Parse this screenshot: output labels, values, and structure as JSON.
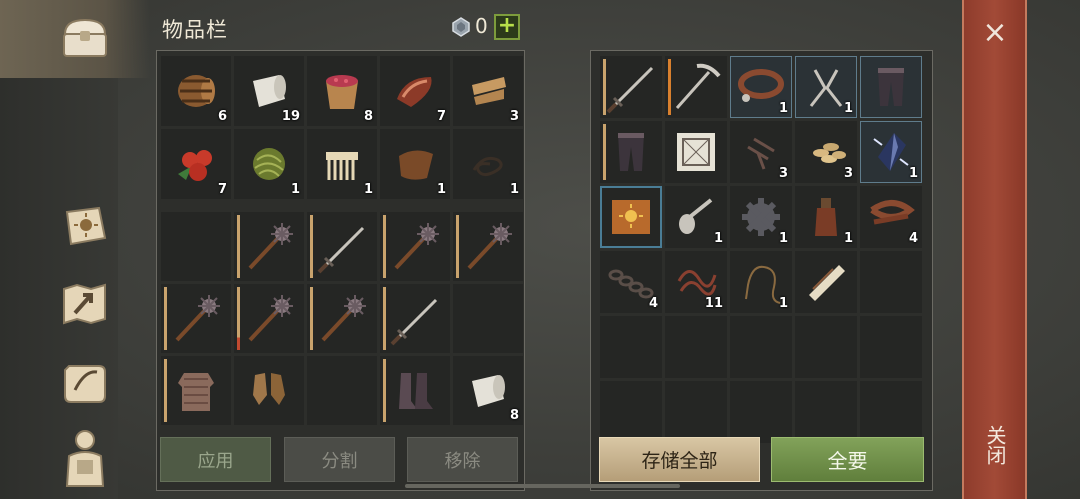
{
  "header": {
    "title": "物品栏",
    "gem_count": "0",
    "plus_label": "+"
  },
  "left_top": [
    {
      "icon": "barrel",
      "count": "6"
    },
    {
      "icon": "cloth-roll",
      "count": "19"
    },
    {
      "icon": "berry-bucket",
      "count": "8"
    },
    {
      "icon": "raw-meat",
      "count": "7"
    },
    {
      "icon": "leather-strips",
      "count": "3"
    },
    {
      "icon": "red-berries",
      "count": "7"
    },
    {
      "icon": "plant-fiber-ball",
      "count": "1"
    },
    {
      "icon": "bone-comb",
      "count": "1"
    },
    {
      "icon": "leather-piece",
      "count": "1"
    },
    {
      "icon": "rope",
      "count": "1"
    }
  ],
  "left_bottom": [
    {
      "icon": "empty",
      "count": ""
    },
    {
      "icon": "spiked-mace",
      "count": ""
    },
    {
      "icon": "sword",
      "count": ""
    },
    {
      "icon": "spiked-mace",
      "count": ""
    },
    {
      "icon": "spiked-mace",
      "count": ""
    },
    {
      "icon": "spiked-mace",
      "count": ""
    },
    {
      "icon": "spiked-mace",
      "count": ""
    },
    {
      "icon": "spiked-mace",
      "count": ""
    },
    {
      "icon": "sword",
      "count": ""
    },
    {
      "icon": "empty",
      "count": ""
    },
    {
      "icon": "chainmail",
      "count": ""
    },
    {
      "icon": "leather-gloves",
      "count": ""
    },
    {
      "icon": "empty",
      "count": ""
    },
    {
      "icon": "boots",
      "count": ""
    },
    {
      "icon": "cloth-roll",
      "count": "8"
    }
  ],
  "right_grid": [
    {
      "icon": "sword",
      "count": ""
    },
    {
      "icon": "pickaxe",
      "count": ""
    },
    {
      "icon": "collar",
      "count": "1"
    },
    {
      "icon": "pliers",
      "count": "1"
    },
    {
      "icon": "leg-armor",
      "count": ""
    },
    {
      "icon": "leg-armor",
      "count": ""
    },
    {
      "icon": "blueprint",
      "count": ""
    },
    {
      "icon": "nails",
      "count": "3"
    },
    {
      "icon": "seeds",
      "count": "3"
    },
    {
      "icon": "crystal",
      "count": "1"
    },
    {
      "icon": "sun-book",
      "count": ""
    },
    {
      "icon": "spoon",
      "count": "1"
    },
    {
      "icon": "gear",
      "count": "1"
    },
    {
      "icon": "bottle",
      "count": "1"
    },
    {
      "icon": "leather-belt",
      "count": "4"
    },
    {
      "icon": "chain",
      "count": "4"
    },
    {
      "icon": "wires",
      "count": "11"
    },
    {
      "icon": "whip",
      "count": "1"
    },
    {
      "icon": "scroll-bundle",
      "count": ""
    },
    {
      "icon": "empty",
      "count": ""
    },
    {
      "icon": "empty",
      "count": ""
    },
    {
      "icon": "empty",
      "count": ""
    },
    {
      "icon": "empty",
      "count": ""
    },
    {
      "icon": "empty",
      "count": ""
    },
    {
      "icon": "empty",
      "count": ""
    },
    {
      "icon": "empty",
      "count": ""
    },
    {
      "icon": "empty",
      "count": ""
    },
    {
      "icon": "empty",
      "count": ""
    },
    {
      "icon": "empty",
      "count": ""
    },
    {
      "icon": "empty",
      "count": ""
    }
  ],
  "buttons": {
    "apply": "应用",
    "split": "分割",
    "remove": "移除",
    "store_all": "存储全部",
    "take_all": "全要"
  },
  "close": {
    "x": "×",
    "label": "关闭"
  },
  "sidebar": [
    "chest-icon",
    "sun-book-icon",
    "map-icon",
    "quest-scroll-icon",
    "character-icon"
  ]
}
